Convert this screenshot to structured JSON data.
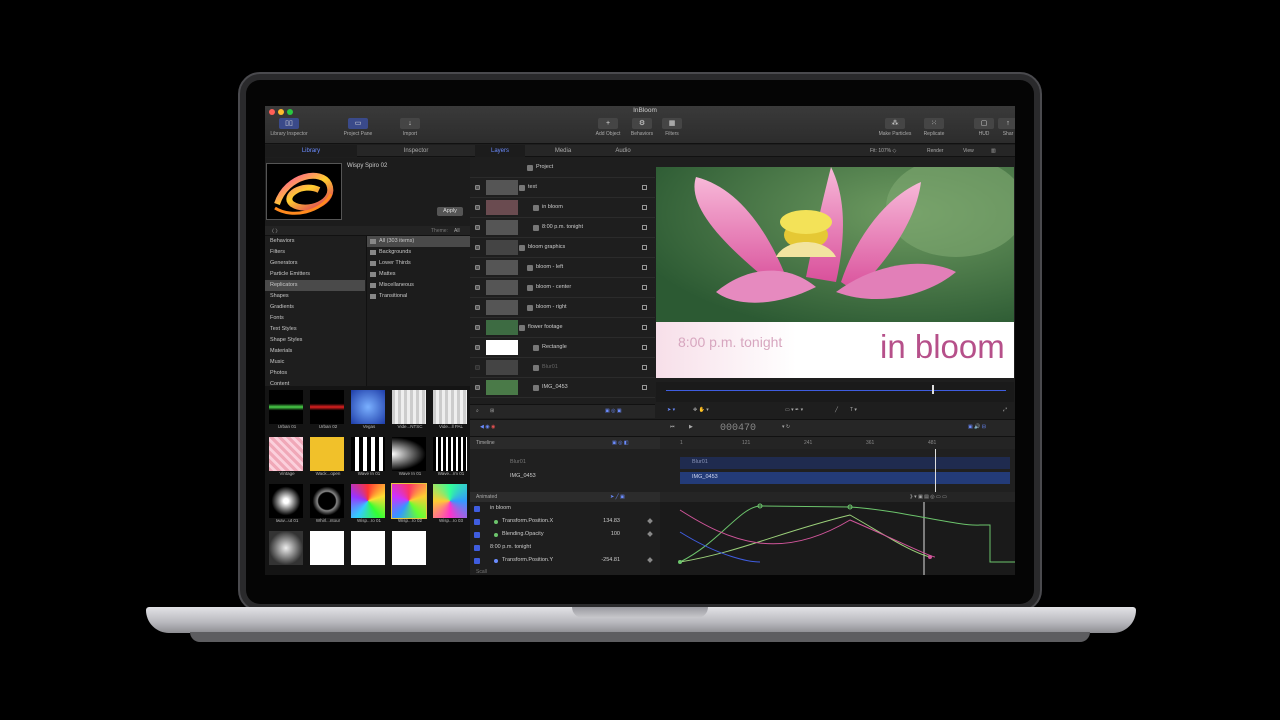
{
  "window": {
    "title": "InBloom"
  },
  "toolbar": {
    "library_inspector": "Library Inspector",
    "project_pane": "Project Pane",
    "import": "Import",
    "add_object": "Add Object",
    "behaviors": "Behaviors",
    "filters": "Filters",
    "make_particles": "Make Particles",
    "replicate": "Replicate",
    "hud": "HUD",
    "share": "Shar"
  },
  "left_tabs": [
    "Library",
    "Inspector"
  ],
  "preview": {
    "name": "Wispy Spiro 02",
    "apply": "Apply"
  },
  "theme": {
    "label": "Theme:",
    "value": "All"
  },
  "categories": [
    "Behaviors",
    "Filters",
    "Generators",
    "Particle Emitters",
    "Replicators",
    "Shapes",
    "Gradients",
    "Fonts",
    "Text Styles",
    "Shape Styles",
    "Materials",
    "Music",
    "Photos",
    "Content"
  ],
  "subcategories": [
    "All (303 items)",
    "Backgrounds",
    "Lower Thirds",
    "Mattes",
    "Miscellaneous",
    "Transitional"
  ],
  "thumbnails": [
    "Urban 01",
    "Urban 02",
    "Vegas",
    "Vide...NTSC",
    "Vide...ll PAL",
    "Vintage",
    "Wack...open",
    "Wave In 01",
    "Wave In 01",
    "Wave...rm 01",
    "Iwav...ut 01",
    "Whirl...ntour",
    "Wisp...ro 01",
    "Wisp...ro 02",
    "Wisp...ro 03",
    "",
    "",
    "",
    ""
  ],
  "mid_tabs": [
    "Layers",
    "Media",
    "Audio"
  ],
  "layers": [
    {
      "name": "Project"
    },
    {
      "name": "text"
    },
    {
      "name": "in bloom"
    },
    {
      "name": "8:00 p.m. tonight"
    },
    {
      "name": "bloom graphics"
    },
    {
      "name": "bloom - left"
    },
    {
      "name": "bloom - center"
    },
    {
      "name": "bloom - right"
    },
    {
      "name": "flower footage"
    },
    {
      "name": "Rectangle"
    },
    {
      "name": "Blur01"
    },
    {
      "name": "IMG_0453"
    }
  ],
  "canvas": {
    "fit": "Fit: 107% ◇",
    "render": "Render",
    "view": "View",
    "subtitle": "8:00 p.m. tonight",
    "title": "in bloom"
  },
  "transport": {
    "timecode": "000470"
  },
  "timeline": {
    "label": "Timeline",
    "tracks": [
      "Blur01",
      "IMG_0453"
    ],
    "ruler": [
      "1",
      "121",
      "241",
      "361",
      "481"
    ]
  },
  "keyframes": {
    "filter": "Animated",
    "params": [
      {
        "name": "in bloom",
        "value": ""
      },
      {
        "name": "Transform.Position.X",
        "value": "134.83"
      },
      {
        "name": "Blending.Opacity",
        "value": "100"
      },
      {
        "name": "8:00 p.m. tonight",
        "value": ""
      },
      {
        "name": "Transform.Position.Y",
        "value": "-254.81"
      }
    ],
    "footer": "Scall"
  },
  "colors": {
    "accent": "#6b8cff",
    "graph_green": "#6cc46c",
    "graph_pink": "#d0559a",
    "graph_blue": "#3f5de0"
  }
}
